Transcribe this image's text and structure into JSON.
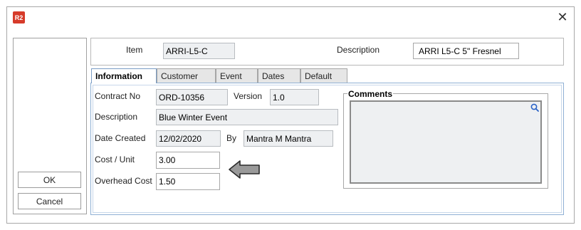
{
  "window": {
    "app_icon_text": "R2",
    "close_glyph": "✕"
  },
  "actions": {
    "ok_label": "OK",
    "cancel_label": "Cancel"
  },
  "header": {
    "item_label": "Item",
    "item_value": "ARRI-L5-C",
    "description_label": "Description",
    "description_value": "ARRI L5-C 5\" Fresnel"
  },
  "tabs": [
    {
      "label": "Information",
      "active": true
    },
    {
      "label": "Customer",
      "active": false
    },
    {
      "label": "Event",
      "active": false
    },
    {
      "label": "Dates",
      "active": false
    },
    {
      "label": "Default",
      "active": false
    }
  ],
  "info": {
    "contract_no_label": "Contract No",
    "contract_no_value": "ORD-10356",
    "version_label": "Version",
    "version_value": "1.0",
    "description_label": "Description",
    "description_value": "Blue Winter Event",
    "date_created_label": "Date Created",
    "date_created_value": "12/02/2020",
    "by_label": "By",
    "by_value": "Mantra M Mantra",
    "cost_unit_label": "Cost / Unit",
    "cost_unit_value": "3.00",
    "overhead_cost_label": "Overhead Cost",
    "overhead_cost_value": "1.50"
  },
  "comments": {
    "title": "Comments",
    "value": ""
  },
  "icons": {
    "app": "app-logo-icon",
    "close": "close-icon",
    "search": "search-icon",
    "arrow": "left-arrow-icon"
  },
  "colors": {
    "active_tab_border": "#7a9cc5",
    "app_icon": "#d63b2a",
    "readonly_field": "#eef0f2"
  }
}
